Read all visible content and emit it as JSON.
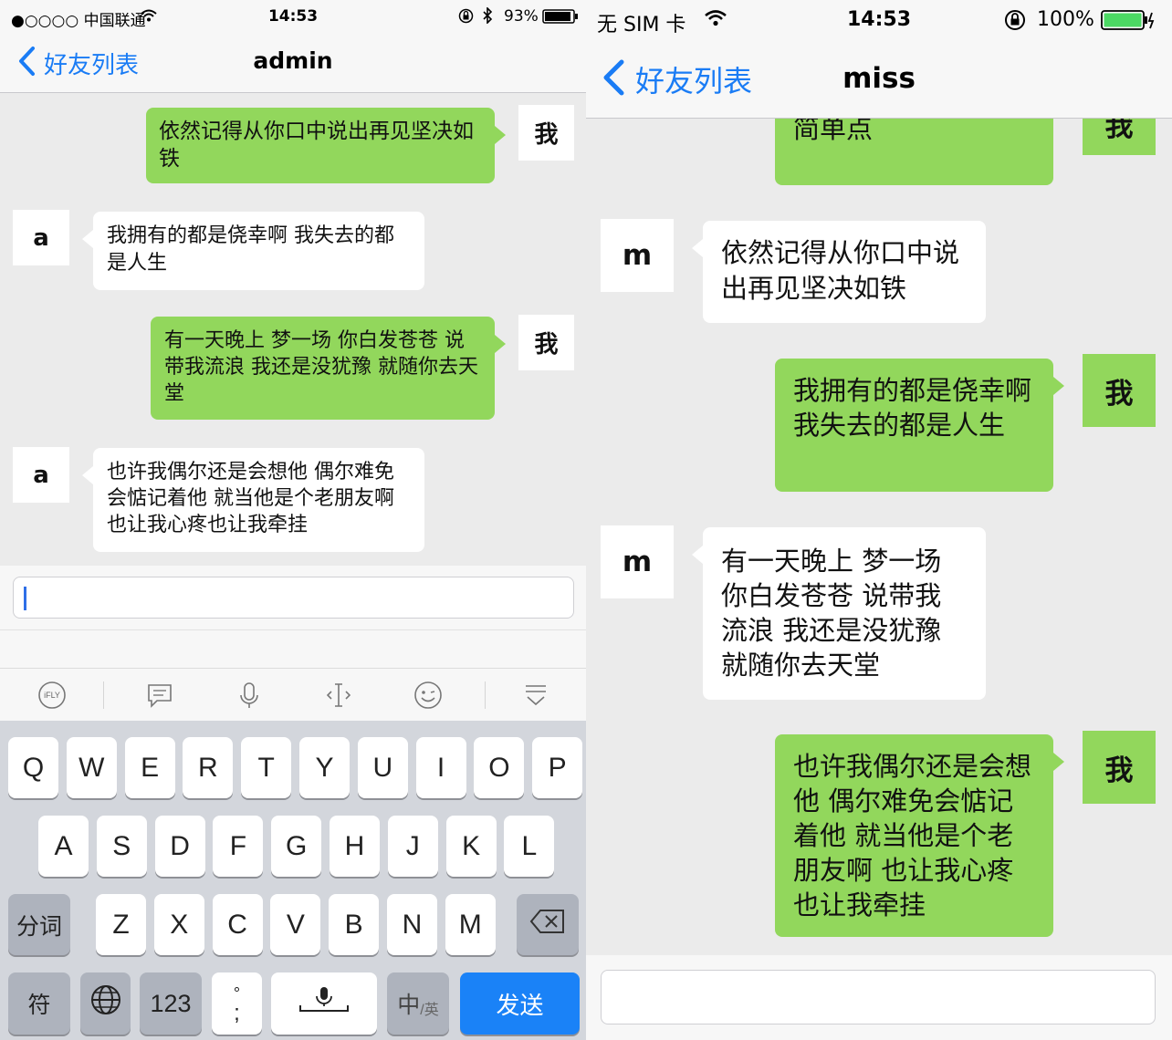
{
  "left": {
    "status": {
      "carrier": "●○○○○ 中国联通",
      "time": "14:53",
      "battery": "93%"
    },
    "nav": {
      "back_label": "好友列表",
      "title": "admin"
    },
    "messages": [
      {
        "from": "me",
        "avatar": "我",
        "text": "依然记得从你口中说出再见坚决如铁"
      },
      {
        "from": "them",
        "avatar": "a",
        "text": "我拥有的都是侥幸啊 我失去的都是人生"
      },
      {
        "from": "me",
        "avatar": "我",
        "text": "有一天晚上 梦一场 你白发苍苍 说带我流浪 我还是没犹豫 就随你去天堂"
      },
      {
        "from": "them",
        "avatar": "a",
        "text": "也许我偶尔还是会想他 偶尔难免会惦记着他 就当他是个老朋友啊 也让我心疼也让我牵挂"
      }
    ],
    "input": {
      "value": "",
      "placeholder": ""
    },
    "toolbar": {
      "icons": [
        "ifly-icon",
        "message-icon",
        "microphone-icon",
        "cursor-icon",
        "emoji-icon",
        "collapse-keyboard-icon"
      ],
      "ifly_text": "iFLY"
    },
    "keyboard": {
      "row1": [
        "Q",
        "W",
        "E",
        "R",
        "T",
        "Y",
        "U",
        "I",
        "O",
        "P"
      ],
      "row2": [
        "A",
        "S",
        "D",
        "F",
        "G",
        "H",
        "J",
        "K",
        "L"
      ],
      "row3": [
        "Z",
        "X",
        "C",
        "V",
        "B",
        "N",
        "M"
      ],
      "segment_key": "分词",
      "symbol_key": "符",
      "num_key": "123",
      "punct_top": "°",
      "punct_bottom": ";",
      "lang_key_main": "中",
      "lang_key_sub": "/英",
      "send_key": "发送"
    }
  },
  "right": {
    "status": {
      "carrier": "无 SIM 卡",
      "time": "14:53",
      "battery": "100%"
    },
    "nav": {
      "back_label": "好友列表",
      "title": "miss"
    },
    "messages": [
      {
        "from": "me",
        "avatar": "我",
        "text": "简单点 说话的方式简单点"
      },
      {
        "from": "them",
        "avatar": "m",
        "text": "依然记得从你口中说出再见坚决如铁"
      },
      {
        "from": "me",
        "avatar": "我",
        "text": "我拥有的都是侥幸啊 我失去的都是人生"
      },
      {
        "from": "them",
        "avatar": "m",
        "text": "有一天晚上 梦一场 你白发苍苍 说带我流浪 我还是没犹豫 就随你去天堂"
      },
      {
        "from": "me",
        "avatar": "我",
        "text": "也许我偶尔还是会想他 偶尔难免会惦记着他 就当他是个老朋友啊 也让我心疼也让我牵挂"
      }
    ],
    "input": {
      "value": "",
      "placeholder": ""
    }
  },
  "colors": {
    "me_bubble": "#92d75c",
    "them_bubble": "#ffffff",
    "accent": "#1a7cf5",
    "send_key": "#1a82f7"
  }
}
